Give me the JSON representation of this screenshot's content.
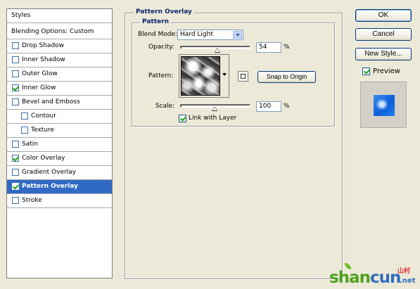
{
  "styles_list": {
    "header": "Styles",
    "blending_options": "Blending Options: Custom",
    "items": [
      {
        "label": "Drop Shadow",
        "checked": false,
        "indent": 0
      },
      {
        "label": "Inner Shadow",
        "checked": false,
        "indent": 0
      },
      {
        "label": "Outer Glow",
        "checked": false,
        "indent": 0
      },
      {
        "label": "Inner Glow",
        "checked": true,
        "indent": 0
      },
      {
        "label": "Bevel and Emboss",
        "checked": false,
        "indent": 0
      },
      {
        "label": "Contour",
        "checked": false,
        "indent": 1
      },
      {
        "label": "Texture",
        "checked": false,
        "indent": 1
      },
      {
        "label": "Satin",
        "checked": false,
        "indent": 0
      },
      {
        "label": "Color Overlay",
        "checked": true,
        "indent": 0
      },
      {
        "label": "Gradient Overlay",
        "checked": false,
        "indent": 0
      },
      {
        "label": "Pattern Overlay",
        "checked": true,
        "indent": 0,
        "selected": true
      },
      {
        "label": "Stroke",
        "checked": false,
        "indent": 0
      }
    ]
  },
  "pattern_overlay": {
    "group_title": "Pattern Overlay",
    "subgroup_title": "Pattern",
    "blend_mode_label": "Blend Mode:",
    "blend_mode_value": "Hard Light",
    "opacity_label": "Opacity:",
    "opacity_value": "54",
    "opacity_unit": "%",
    "opacity_level": 0.54,
    "pattern_label": "Pattern:",
    "snap_button": "Snap to Origin",
    "scale_label": "Scale:",
    "scale_value": "100",
    "scale_unit": "%",
    "scale_level": 0.5,
    "link_label": "Link with Layer",
    "link_checked": true
  },
  "buttons": {
    "ok": "OK",
    "cancel": "Cancel",
    "new_style": "New Style...",
    "preview_label": "Preview",
    "preview_checked": true
  },
  "watermark": {
    "text_green": "shan",
    "text_blue": "cun",
    "text_suffix": ".net",
    "text_cn": "山村"
  },
  "colors": {
    "dialog_bg": "#ece9d8",
    "selection": "#316ac5",
    "legend_text": "#0a246a",
    "check_green": "#21a121"
  }
}
